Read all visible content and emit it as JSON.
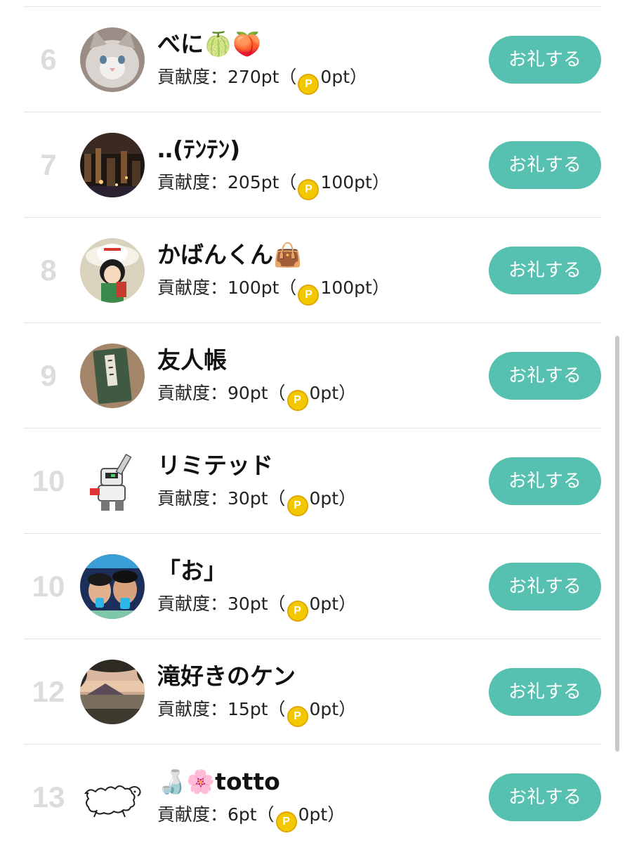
{
  "contribution_prefix": "貢献度：",
  "paren_open": "（",
  "paren_close": "）",
  "thanks_button_label": "お礼する",
  "coin_glyph": "P",
  "colors": {
    "accent_button": "#56c1b0",
    "rank_text": "#dcdcdc",
    "divider": "#e3e3e3",
    "coin": "#f3c800"
  },
  "rows": [
    {
      "rank": "6",
      "name": "べに🍈🍑",
      "points": "270pt",
      "coin_points": "0pt",
      "avatar_icon": "cat-photo-avatar"
    },
    {
      "rank": "7",
      "name": "‥(ﾃﾝﾃﾝ)",
      "points": "205pt",
      "coin_points": "100pt",
      "avatar_icon": "night-city-avatar"
    },
    {
      "rank": "8",
      "name": "かばんくん👜",
      "points": "100pt",
      "coin_points": "100pt",
      "avatar_icon": "anime-character-avatar"
    },
    {
      "rank": "9",
      "name": "友人帳",
      "points": "90pt",
      "coin_points": "0pt",
      "avatar_icon": "book-avatar"
    },
    {
      "rank": "10",
      "name": "リミテッド",
      "points": "30pt",
      "coin_points": "0pt",
      "avatar_icon": "robot-figure-avatar"
    },
    {
      "rank": "10",
      "name": "「お」",
      "points": "30pt",
      "coin_points": "0pt",
      "avatar_icon": "two-people-avatar"
    },
    {
      "rank": "12",
      "name": "滝好きのケン",
      "points": "15pt",
      "coin_points": "0pt",
      "avatar_icon": "sunset-landscape-avatar"
    },
    {
      "rank": "13",
      "name": "🍶🌸totto",
      "points": "6pt",
      "coin_points": "0pt",
      "avatar_icon": "sheep-sketch-avatar"
    }
  ]
}
